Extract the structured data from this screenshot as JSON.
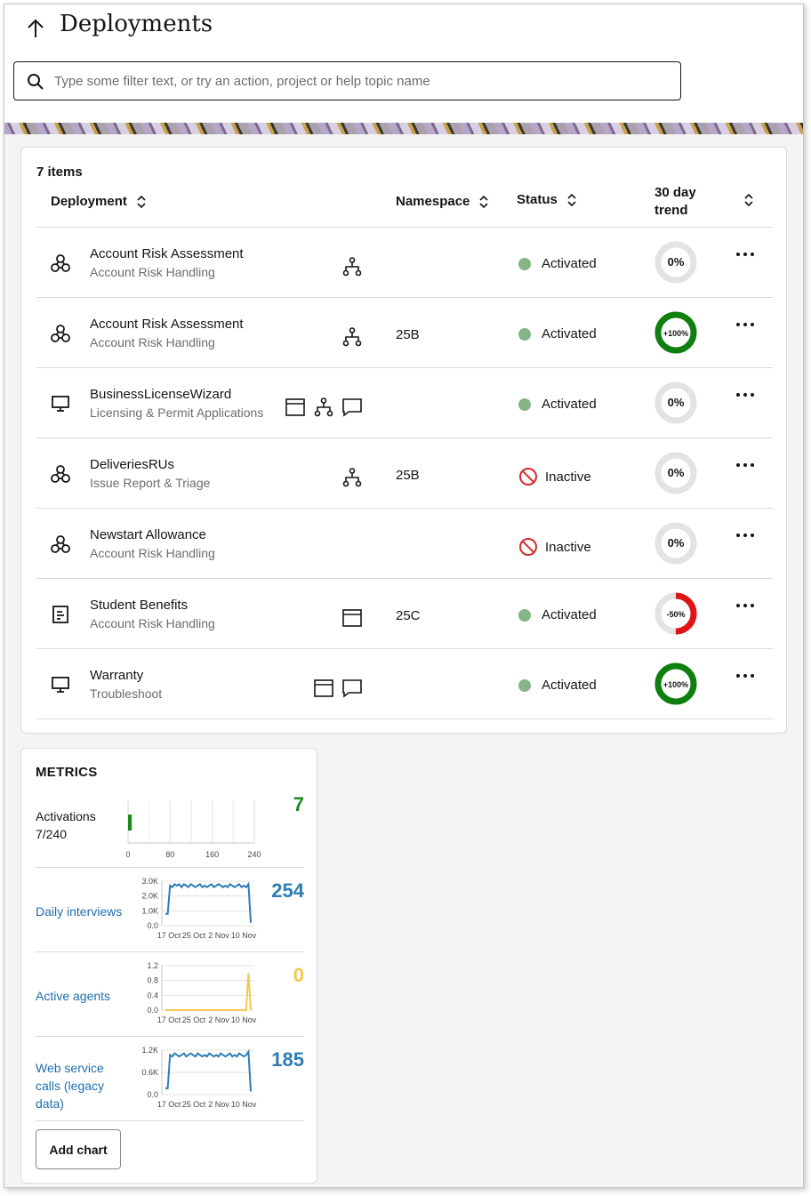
{
  "header": {
    "title": "Deployments",
    "search_placeholder": "Type some filter text, or try an action, project or help topic name"
  },
  "table": {
    "items_count": "7 items",
    "columns": {
      "deployment": "Deployment",
      "namespace": "Namespace",
      "status": "Status",
      "trend": "30 day trend"
    },
    "rows": [
      {
        "name": "Account Risk Assessment",
        "project": "Account Risk Handling",
        "type_icon": "web-service-icon",
        "features": [
          "org-chart-icon"
        ],
        "namespace": "",
        "status": "Activated",
        "trend": "0%",
        "trend_value": 0
      },
      {
        "name": "Account Risk Assessment",
        "project": "Account Risk Handling",
        "type_icon": "web-service-icon",
        "features": [
          "org-chart-icon"
        ],
        "namespace": "25B",
        "status": "Activated",
        "trend": "+100%",
        "trend_value": 100
      },
      {
        "name": "BusinessLicenseWizard",
        "project": "Licensing & Permit Applications",
        "type_icon": "monitor-icon",
        "features": [
          "window-icon",
          "org-chart-icon",
          "chat-bubble-icon"
        ],
        "namespace": "",
        "status": "Activated",
        "trend": "0%",
        "trend_value": 0
      },
      {
        "name": "DeliveriesRUs",
        "project": "Issue Report & Triage",
        "type_icon": "web-service-icon",
        "features": [
          "org-chart-icon"
        ],
        "namespace": "25B",
        "status": "Inactive",
        "trend": "0%",
        "trend_value": 0
      },
      {
        "name": "Newstart Allowance",
        "project": "Account Risk Handling",
        "type_icon": "web-service-icon",
        "features": [],
        "namespace": "",
        "status": "Inactive",
        "trend": "0%",
        "trend_value": 0
      },
      {
        "name": "Student Benefits",
        "project": "Account Risk Handling",
        "type_icon": "form-icon",
        "features": [
          "window-icon"
        ],
        "namespace": "25C",
        "status": "Activated",
        "trend": "-50%",
        "trend_value": -50
      },
      {
        "name": "Warranty",
        "project": "Troubleshoot",
        "type_icon": "monitor-icon",
        "features": [
          "window-icon",
          "chat-bubble-icon"
        ],
        "namespace": "",
        "status": "Activated",
        "trend": "+100%",
        "trend_value": 100
      }
    ]
  },
  "metrics": {
    "title": "METRICS",
    "activations": {
      "label": "Activations",
      "sub": "7/240",
      "value": "7",
      "ticks": [
        "0",
        "80",
        "160",
        "240"
      ]
    },
    "daily_interviews": {
      "label": "Daily interviews",
      "value": "254",
      "yticks": [
        "3.0K",
        "2.0K",
        "1.0K",
        "0.0"
      ],
      "xticks": [
        "17 Oct",
        "25 Oct",
        "2 Nov",
        "10 Nov"
      ]
    },
    "active_agents": {
      "label": "Active agents",
      "value": "0",
      "yticks": [
        "1.2",
        "0.8",
        "0.4",
        "0.0"
      ],
      "xticks": [
        "17 Oct",
        "25 Oct",
        "2 Nov",
        "10 Nov"
      ]
    },
    "web_service_calls": {
      "label": "Web service calls (legacy data)",
      "value": "185",
      "yticks": [
        "1.2K",
        "0.6K",
        "0.0"
      ],
      "xticks": [
        "17 Oct",
        "25 Oct",
        "2 Nov",
        "10 Nov"
      ]
    },
    "add_chart_label": "Add chart"
  },
  "chart_data": [
    {
      "type": "bar",
      "title": "Activations",
      "values": [
        7
      ],
      "xlim": [
        0,
        240
      ],
      "xticks": [
        0,
        80,
        160,
        240
      ],
      "color": "#1e8a1e"
    },
    {
      "type": "line",
      "title": "Daily interviews",
      "x": [
        "17 Oct",
        "25 Oct",
        "2 Nov",
        "10 Nov"
      ],
      "ylim": [
        0,
        3000
      ],
      "values": [
        800,
        800,
        2700,
        2600,
        2800,
        2700,
        2800,
        2600,
        2800,
        2700,
        2600,
        2800,
        2700,
        2600,
        2700,
        2800,
        2600,
        2700,
        2600,
        2700,
        2800,
        2600,
        2700,
        2800,
        2700,
        2600,
        2700,
        2600,
        2800,
        2700,
        2600,
        2700,
        2800,
        2600,
        2700,
        2600,
        2800,
        200
      ],
      "color": "#2e7db5"
    },
    {
      "type": "line",
      "title": "Active agents",
      "x": [
        "17 Oct",
        "25 Oct",
        "2 Nov",
        "10 Nov"
      ],
      "ylim": [
        0,
        1.2
      ],
      "values": [
        0,
        0,
        0,
        0,
        0,
        0,
        0,
        0,
        0,
        0,
        0,
        0,
        0,
        0,
        0,
        0,
        0,
        0,
        0,
        0,
        0,
        0,
        0,
        0,
        0,
        0,
        0,
        0,
        0,
        0,
        0,
        0,
        0,
        0,
        0,
        0,
        1.0,
        0
      ],
      "color": "#f2c94c"
    },
    {
      "type": "line",
      "title": "Web service calls (legacy data)",
      "x": [
        "17 Oct",
        "25 Oct",
        "2 Nov",
        "10 Nov"
      ],
      "ylim": [
        0,
        1400
      ],
      "values": [
        200,
        200,
        1250,
        1200,
        1300,
        1250,
        1200,
        1250,
        1300,
        1200,
        1250,
        1300,
        1250,
        1200,
        1300,
        1250,
        1200,
        1250,
        1200,
        1300,
        1250,
        1200,
        1250,
        1200,
        1300,
        1250,
        1200,
        1250,
        1300,
        1200,
        1250,
        1200,
        1300,
        1250,
        1200,
        1250,
        1350,
        100
      ],
      "color": "#2e7db5"
    }
  ],
  "colors": {
    "activated": "#85b486",
    "inactive": "#d42b2b",
    "positive": "#0f7f0f",
    "negative": "#e01414",
    "neutral": "#e4e3e1",
    "link": "#1f6fae"
  }
}
